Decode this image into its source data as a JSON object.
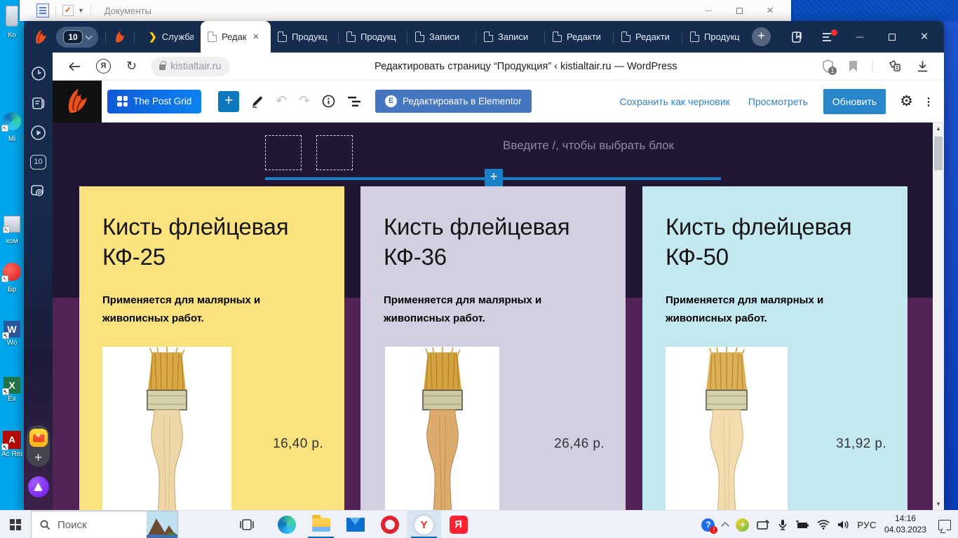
{
  "desktop": {
    "back_window_title": "Документы",
    "icons": [
      {
        "label": "Ко"
      },
      {
        "label": "Mi"
      },
      {
        "label": "ком"
      },
      {
        "label": "Бр"
      },
      {
        "label": "Wo"
      },
      {
        "label": "Ex"
      },
      {
        "label": "Ac Rea"
      }
    ]
  },
  "browser": {
    "tab_group_count": "10",
    "sidebar_counter": "10",
    "tabs": [
      {
        "label": "Служба"
      },
      {
        "label": "Редак"
      },
      {
        "label": "Продукц"
      },
      {
        "label": "Продукц"
      },
      {
        "label": "Записи"
      },
      {
        "label": "Записи"
      },
      {
        "label": "Редакти"
      },
      {
        "label": "Редакти"
      },
      {
        "label": "Продукц"
      }
    ],
    "address": {
      "url": "kistialtair.ru",
      "page_title": "Редактировать страницу “Продукция” ‹ kistialtair.ru — WordPress",
      "protect_badge": "1"
    }
  },
  "wp": {
    "post_grid_button": "The Post Grid",
    "elementor_button": "Редактировать в Elementor",
    "save_draft": "Сохранить как черновик",
    "preview": "Просмотреть",
    "update": "Обновить"
  },
  "editor": {
    "block_placeholder": "Введите /, чтобы выбрать блок",
    "products": [
      {
        "title": "Кисть флейцевая КФ-25",
        "description": "Применяется  для малярных и живописных  работ.",
        "price": "16,40 р.",
        "bg": "#fae37e"
      },
      {
        "title": "Кисть флейцевая КФ-36",
        "description": "Применяется  для малярных и живописных  работ.",
        "price": "26,46 р.",
        "bg": "#d3cfe1"
      },
      {
        "title": "Кисть флейцевая КФ-50",
        "description": "Применяется  для малярных и живописных  работ.",
        "price": "31,92 р.",
        "bg": "#c4e8ef"
      }
    ]
  },
  "taskbar": {
    "search_placeholder": "Поиск",
    "language": "РУС",
    "time": "14:16",
    "date": "04.03.2023",
    "yandex_browser_letter": "Y",
    "yandex_search_letter": "Я"
  },
  "colors": {
    "chrome": "#152c4f",
    "canvas_top": "#211634",
    "canvas_bottom": "#522356",
    "accent_blue": "#1a80c8",
    "wp_update_button": "#2787c9"
  }
}
